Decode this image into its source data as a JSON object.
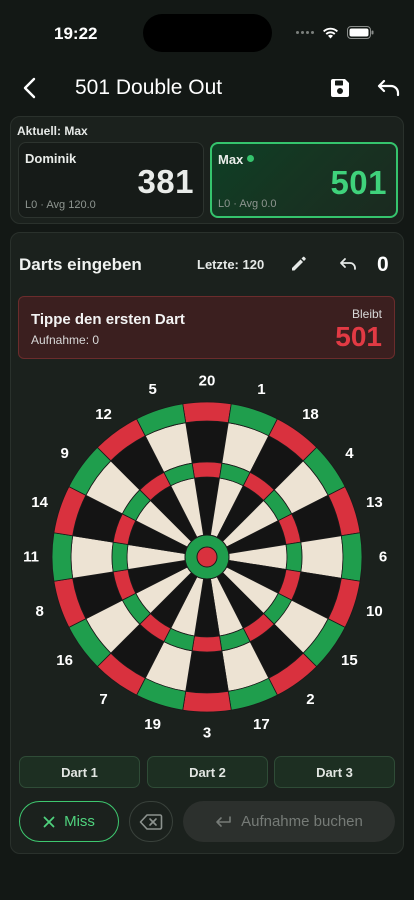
{
  "status": {
    "time": "19:22"
  },
  "header": {
    "title": "501 Double Out"
  },
  "players": {
    "current_label": "Aktuell: Max",
    "list": [
      {
        "name": "Dominik",
        "score": "381",
        "stats": "L0 · Avg 120.0",
        "active": false
      },
      {
        "name": "Max",
        "score": "501",
        "stats": "L0 · Avg 0.0",
        "active": true
      }
    ]
  },
  "entry": {
    "title": "Darts eingeben",
    "last": "Letzte: 120",
    "throw_count": "0",
    "prompt": {
      "title": "Tippe den ersten Dart",
      "subtitle": "Aufnahme: 0",
      "remain_label": "Bleibt",
      "remain_value": "501"
    }
  },
  "dartboard": {
    "numbers": [
      "20",
      "1",
      "18",
      "4",
      "13",
      "6",
      "10",
      "15",
      "2",
      "17",
      "3",
      "19",
      "7",
      "16",
      "8",
      "11",
      "14",
      "9",
      "12",
      "5"
    ],
    "colors": {
      "black": "#141414",
      "cream": "#ede3d3",
      "red": "#d9313e",
      "green": "#1f9e4d",
      "bull_outer": "#1f9e4d",
      "bull_inner": "#d9313e"
    }
  },
  "darts": {
    "slots": [
      "Dart 1",
      "Dart 2",
      "Dart 3"
    ]
  },
  "actions": {
    "miss": "Miss",
    "book": "Aufnahme buchen"
  },
  "icons": {
    "back": "chevron-left-icon",
    "save": "save-icon",
    "undo": "undo-icon",
    "edit": "pencil-icon",
    "miss": "close-icon",
    "backspace": "backspace-icon",
    "book": "return-icon"
  },
  "colors": {
    "accent": "#35c46d",
    "danger": "#e23a44",
    "background": "#131815"
  }
}
